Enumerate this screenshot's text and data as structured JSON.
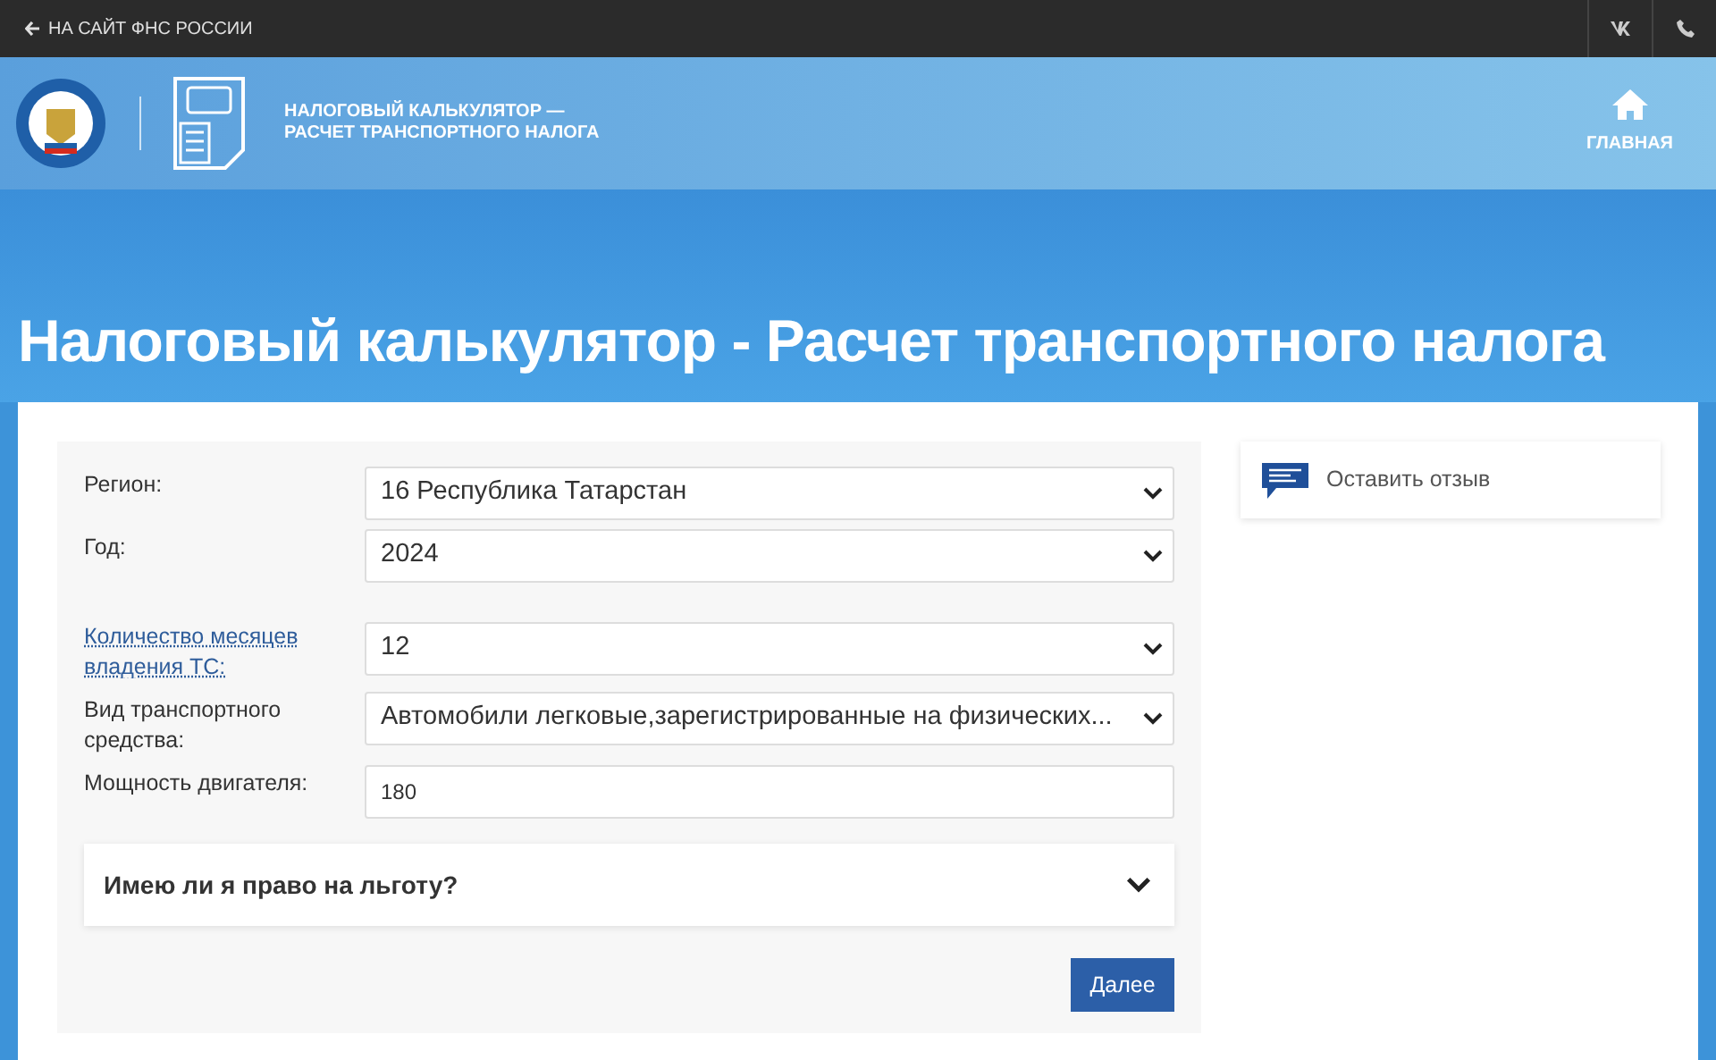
{
  "top_bar": {
    "back_link": "НА САЙТ ФНС РОССИИ"
  },
  "header": {
    "title_lines": [
      "НАЛОГОВЫЙ КАЛЬКУЛЯТОР —",
      "РАСЧЕТ ТРАНСПОРТНОГО НАЛОГА"
    ],
    "home_link": "ГЛАВНАЯ"
  },
  "page_title": "Налоговый калькулятор - Расчет транспортного налога",
  "form": {
    "fields": [
      {
        "label": "Регион:",
        "label_is_link": false,
        "kind": "select",
        "value": "16 Республика Татарстан"
      },
      {
        "label": "Год:",
        "label_is_link": false,
        "kind": "select",
        "value": "2024"
      },
      {
        "label": "Количество месяцев владения ТС:",
        "label_is_link": true,
        "kind": "select",
        "value": "12"
      },
      {
        "label": "Вид транспортного средства:",
        "label_is_link": false,
        "kind": "select",
        "value": "Автомобили легковые,зарегистрированные на физических..."
      },
      {
        "label": "Мощность двигателя:",
        "label_is_link": false,
        "kind": "input",
        "value": "180"
      }
    ],
    "accordion": {
      "title": "Имею ли я право на льготу?",
      "expanded": false
    },
    "submit": "Далее"
  },
  "feedback": {
    "label": "Оставить отзыв"
  }
}
